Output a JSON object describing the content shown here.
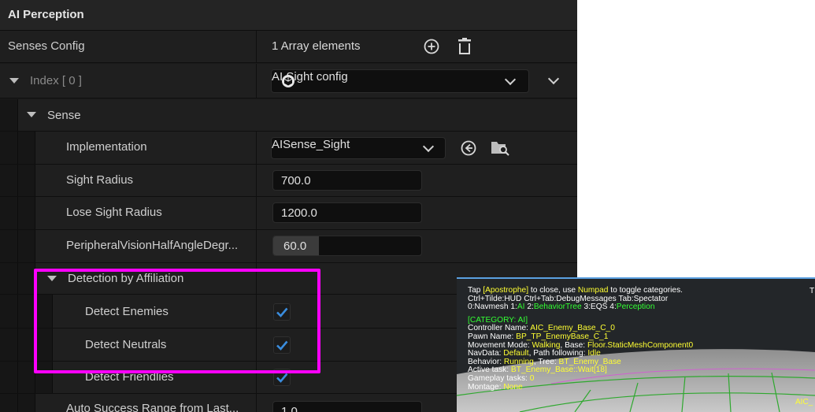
{
  "panel": {
    "title": "AI Perception"
  },
  "senses_config": {
    "label": "Senses Config",
    "count_text": "1 Array elements"
  },
  "index_row": {
    "label": "Index [ 0 ]",
    "value": "AI Sight config"
  },
  "sense_row": {
    "label": "Sense"
  },
  "implementation": {
    "label": "Implementation",
    "value": "AISense_Sight"
  },
  "sight_radius": {
    "label": "Sight Radius",
    "value": "700.0"
  },
  "lose_sight_radius": {
    "label": "Lose Sight Radius",
    "value": "1200.0"
  },
  "peripheral": {
    "label": "PeripheralVisionHalfAngleDegr...",
    "value": "60.0"
  },
  "detection": {
    "label": "Detection by Affiliation"
  },
  "detect_enemies": {
    "label": "Detect Enemies",
    "checked": true
  },
  "detect_neutrals": {
    "label": "Detect Neutrals",
    "checked": true
  },
  "detect_friendlies": {
    "label": "Detect Friendlies",
    "checked": true
  },
  "partial_row": {
    "label": "Auto Success Range from Last...",
    "value": "1.0"
  },
  "debug": {
    "line1_a": "Tap ",
    "line1_key1": "[Apostrophe]",
    "line1_b": " to close, use ",
    "line1_key2": "Numpad",
    "line1_c": " to toggle categories.",
    "line1_right": "T",
    "line2": "Ctrl+Tilde:HUD  Ctrl+Tab:DebugMessages  Tab:Spectator",
    "line3_a": "0:Navmesh  1:",
    "line3_ai": "AI",
    "line3_b": "  2:",
    "line3_bt": "BehaviorTree",
    "line3_c": "  3:EQS  4:",
    "line3_p": "Perception",
    "category": "[CATEGORY: AI]",
    "controller_label": "Controller Name: ",
    "controller_value": "AIC_Enemy_Base_C_0",
    "pawn_label": "Pawn Name: ",
    "pawn_value": "BP_TP_EnemyBase_C_1",
    "movement_label": "Movement Mode: ",
    "movement_value": "Walking",
    "movement_base_label": ", Base: ",
    "movement_base_value": "Floor.StaticMeshComponent0",
    "navdata_label": "NavData: ",
    "navdata_value": "Default",
    "path_label": ", Path following: ",
    "path_value": "Idle",
    "behavior_label": "Behavior: ",
    "behavior_value": "Running",
    "tree_label": ", Tree: ",
    "tree_value": "BT_Enemy_Base",
    "active_label": "Active task: ",
    "active_value": "BT_Enemy_Base::Wait[18]",
    "gameplay_label": "Gameplay tasks: ",
    "gameplay_value": "0",
    "montage_label": "Montage: ",
    "montage_value": "None",
    "aic_tag": "AIC_"
  },
  "colors": {
    "highlight": "#ff00ff",
    "check": "#3a8dde",
    "debug_yellow": "#ffff33",
    "debug_green": "#33ff33"
  }
}
